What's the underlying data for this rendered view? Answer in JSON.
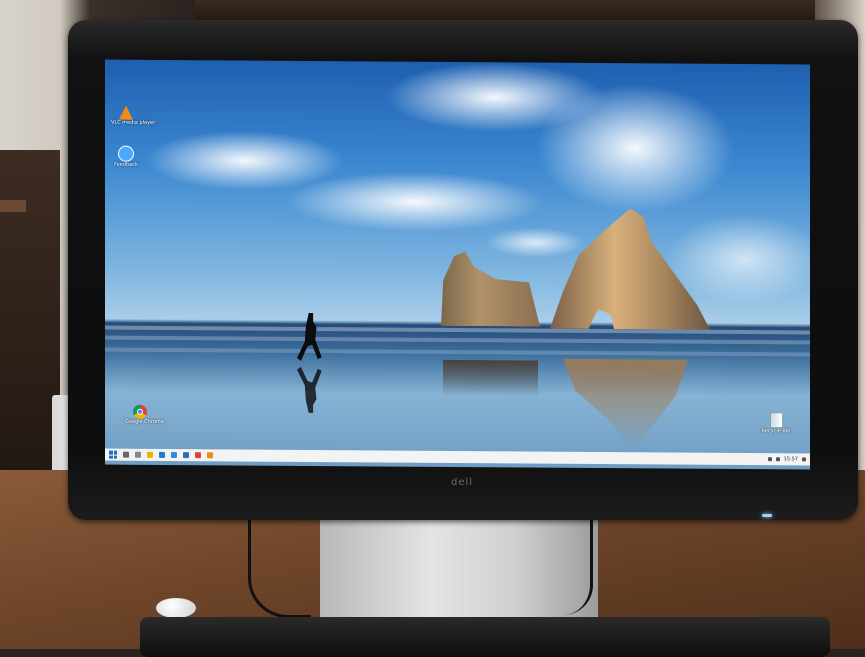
{
  "scene": {
    "monitor_logo": "dell",
    "desktop_icons": [
      {
        "name": "vlc-icon",
        "label": "VLC media player"
      },
      {
        "name": "app2-icon",
        "label": "Feedback"
      },
      {
        "name": "chrome-icon",
        "label": "Google Chrome"
      },
      {
        "name": "recycle-bin-icon",
        "label": "Recycle Bin"
      }
    ],
    "taskbar": {
      "tray_time": "15:57"
    }
  },
  "colors": {
    "taskbar_bg": "#f3f3f3",
    "sky_top": "#1e5fb0",
    "start_blue": "#1a73c7"
  }
}
